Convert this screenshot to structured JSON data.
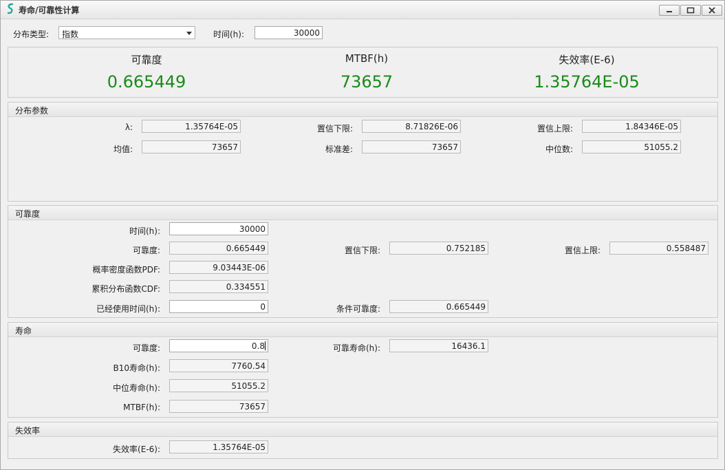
{
  "window": {
    "title": "寿命/可靠性计算"
  },
  "top": {
    "dist_type_label": "分布类型:",
    "dist_type_value": "指数",
    "time_label": "时间(h):",
    "time_value": "30000"
  },
  "summary": {
    "reliability_label": "可靠度",
    "reliability_value": "0.665449",
    "mtbf_label": "MTBF(h)",
    "mtbf_value": "73657",
    "failure_rate_label": "失效率(E-6)",
    "failure_rate_value": "1.35764E-05"
  },
  "dist_params": {
    "title": "分布参数",
    "lambda_label": "λ:",
    "lambda_value": "1.35764E-05",
    "conf_lower_label": "置信下限:",
    "conf_lower_value": "8.71826E-06",
    "conf_upper_label": "置信上限:",
    "conf_upper_value": "1.84346E-05",
    "mean_label": "均值:",
    "mean_value": "73657",
    "stddev_label": "标准差:",
    "stddev_value": "73657",
    "median_label": "中位数:",
    "median_value": "51055.2"
  },
  "reliability": {
    "title": "可靠度",
    "time_label": "时间(h):",
    "time_value": "30000",
    "rel_label": "可靠度:",
    "rel_value": "0.665449",
    "conf_lower_label": "置信下限:",
    "conf_lower_value": "0.752185",
    "conf_upper_label": "置信上限:",
    "conf_upper_value": "0.558487",
    "pdf_label": "概率密度函数PDF:",
    "pdf_value": "9.03443E-06",
    "cdf_label": "累积分布函数CDF:",
    "cdf_value": "0.334551",
    "used_time_label": "已经使用时间(h):",
    "used_time_value": "0",
    "cond_rel_label": "条件可靠度:",
    "cond_rel_value": "0.665449"
  },
  "life": {
    "title": "寿命",
    "rel_label": "可靠度:",
    "rel_value": "0.8",
    "rel_life_label": "可靠寿命(h):",
    "rel_life_value": "16436.1",
    "b10_label": "B10寿命(h):",
    "b10_value": "7760.54",
    "median_label": "中位寿命(h):",
    "median_value": "51055.2",
    "mtbf_label": "MTBF(h):",
    "mtbf_value": "73657"
  },
  "failure_rate": {
    "title": "失效率",
    "label": "失效率(E-6):",
    "value": "1.35764E-05"
  },
  "colors": {
    "summary_value": "#1a8a1a",
    "app_icon": "#2aa59a"
  }
}
